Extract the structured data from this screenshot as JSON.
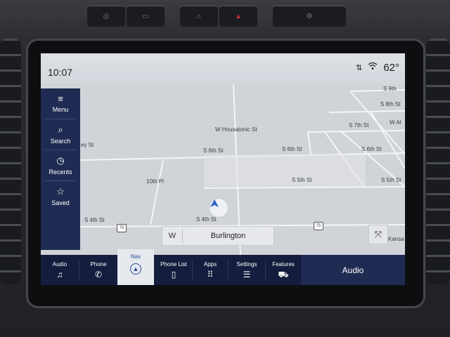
{
  "status_bar": {
    "time": "10:07",
    "temperature": "62°"
  },
  "left_menu": {
    "items": [
      {
        "label": "Menu",
        "icon": "hamburger-icon"
      },
      {
        "label": "Search",
        "icon": "search-icon"
      },
      {
        "label": "Recents",
        "icon": "clock-icon"
      },
      {
        "label": "Saved",
        "icon": "star-icon"
      }
    ]
  },
  "map": {
    "streets": [
      "S 9th",
      "S 8th St",
      "W Housatonic St",
      "S 7th St",
      "W Al",
      "ey St",
      "S 6th St",
      "S 6th St",
      "S 6th St",
      "10th Pl",
      "S 5th St",
      "S 5th St",
      "S 4th St",
      "S 4th St",
      "Kansa"
    ],
    "route_shields": [
      "75",
      "75"
    ],
    "direction": "W",
    "current_street": "Burlington"
  },
  "bottom_bar": {
    "items": [
      {
        "label": "Audio",
        "icon": "music-note-icon"
      },
      {
        "label": "Phone",
        "icon": "phone-icon"
      },
      {
        "label": "Nav",
        "icon": "navigation-icon"
      },
      {
        "label": "Phone List",
        "icon": "phone-list-icon"
      },
      {
        "label": "Apps",
        "icon": "apps-grid-icon"
      },
      {
        "label": "Settings",
        "icon": "sliders-icon"
      },
      {
        "label": "Features",
        "icon": "car-icon"
      }
    ],
    "audio_button": "Audio"
  },
  "colors": {
    "menu_bg": "#1f2b52",
    "bottom_bar_bg": "#141d3d",
    "nav_accent": "#2a4c9c"
  }
}
